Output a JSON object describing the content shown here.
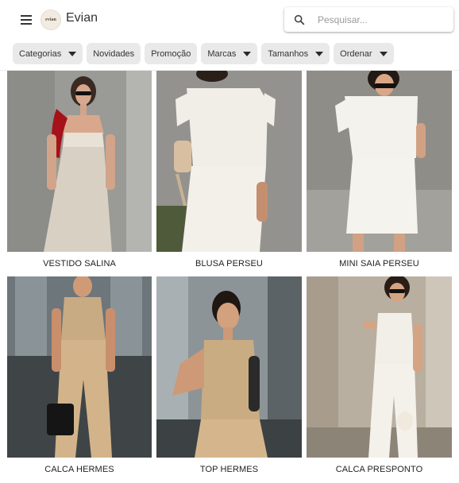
{
  "header": {
    "brand": "Evian",
    "logo_text": "evian",
    "search_placeholder": "Pesquisar..."
  },
  "filters": [
    {
      "label": "Categorias",
      "dropdown": true
    },
    {
      "label": "Novidades",
      "dropdown": false
    },
    {
      "label": "Promoção",
      "dropdown": false
    },
    {
      "label": "Marcas",
      "dropdown": true
    },
    {
      "label": "Tamanhos",
      "dropdown": true
    },
    {
      "label": "Ordenar",
      "dropdown": true
    }
  ],
  "products": [
    {
      "name": "VESTIDO SALINA"
    },
    {
      "name": "BLUSA PERSEU"
    },
    {
      "name": "MINI SAIA PERSEU"
    },
    {
      "name": "CALCA HERMES"
    },
    {
      "name": "TOP HERMES"
    },
    {
      "name": "CALCA PRESPONTO"
    }
  ],
  "colors": {
    "chip_bg": "#e9e9e9",
    "text": "#212121",
    "beige": "#cdb08a",
    "white_outfit": "#f3f1ec"
  }
}
